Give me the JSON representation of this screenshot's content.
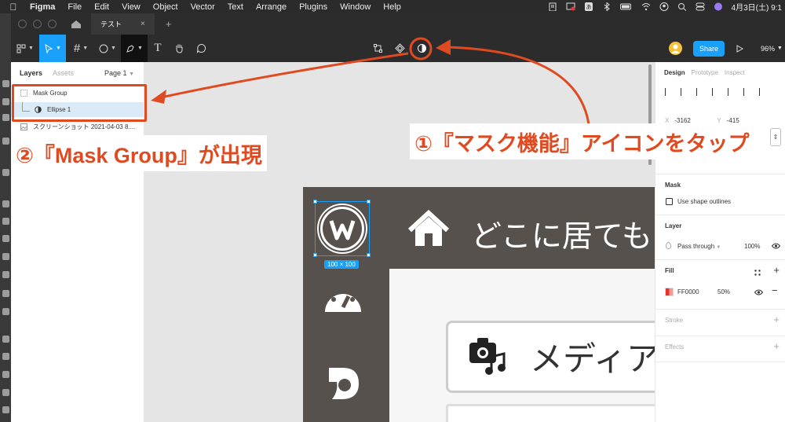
{
  "mac_menubar": {
    "app": "Figma",
    "menus": [
      "File",
      "Edit",
      "View",
      "Object",
      "Vector",
      "Text",
      "Arrange",
      "Plugins",
      "Window",
      "Help"
    ],
    "clock": "4月3日(土) 9:1"
  },
  "window": {
    "tab_title": "テスト",
    "tab_close": "×",
    "new_tab": "+"
  },
  "toolbar": {
    "share_label": "Share",
    "zoom_label": "96%",
    "text_tool_glyph": "T"
  },
  "layers_panel": {
    "tab_layers": "Layers",
    "tab_assets": "Assets",
    "page_label": "Page 1",
    "items": [
      {
        "name": "Mask Group",
        "type": "group"
      },
      {
        "name": "Ellipse 1",
        "type": "ellipse"
      },
      {
        "name": "スクリーンショット 2021-04-03 8....",
        "type": "image"
      }
    ]
  },
  "canvas": {
    "frame_title": "どこに居ても",
    "media_label": "メディア",
    "selection_size": "100 × 100"
  },
  "design_panel": {
    "tab_design": "Design",
    "tab_prototype": "Prototype",
    "tab_inspect": "Inspect",
    "x_label": "X",
    "x_value": "-3162",
    "y_label": "Y",
    "y_value": "-415",
    "mask_header": "Mask",
    "mask_option": "Use shape outlines",
    "layer_header": "Layer",
    "blend_mode": "Pass through",
    "layer_opacity": "100%",
    "fill_header": "Fill",
    "fill_hex": "FF0000",
    "fill_opacity": "50%",
    "fill_color": "#e8322a",
    "stroke_header": "Stroke",
    "effects_header": "Effects"
  },
  "annotations": {
    "step1": "①『マスク機能』アイコンをタップ",
    "step2": "②『Mask Group』が出現",
    "accent_color": "#e04a20"
  }
}
